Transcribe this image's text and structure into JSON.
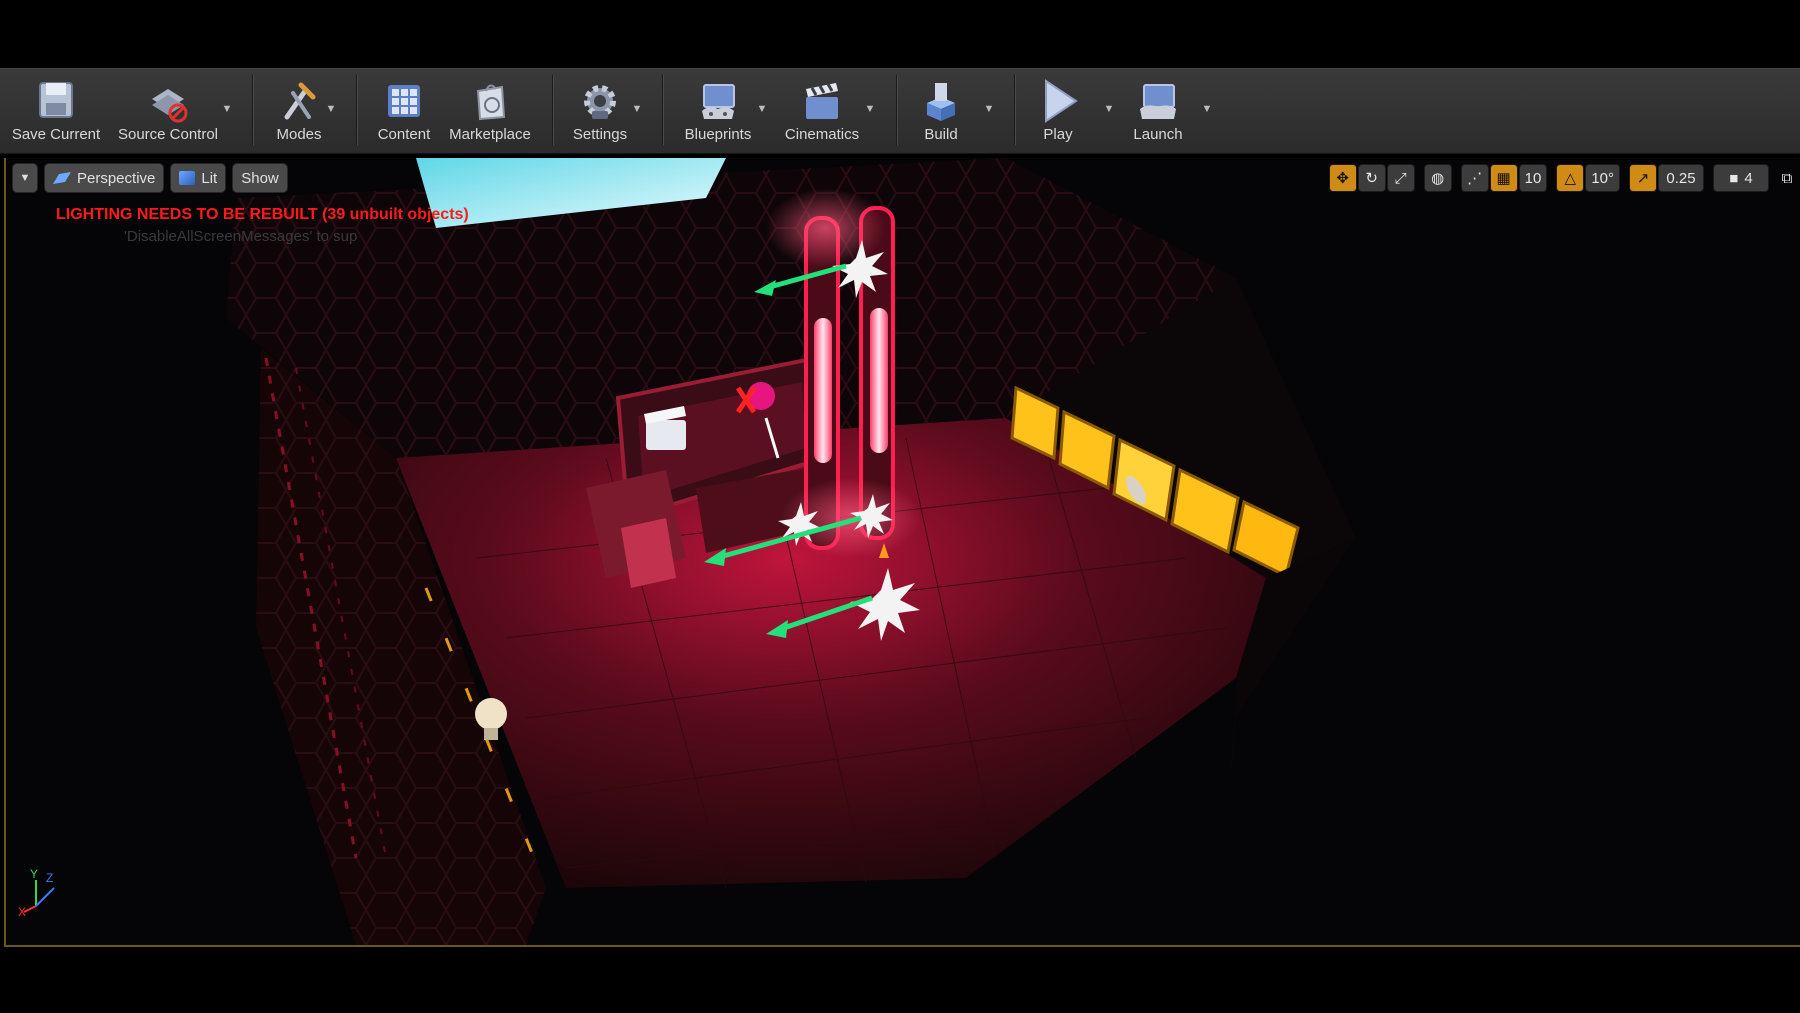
{
  "toolbar": {
    "buttons": [
      {
        "label": "Save Current",
        "icon": "save-icon"
      },
      {
        "label": "Source Control",
        "icon": "source-control-icon"
      },
      {
        "label": "Modes",
        "icon": "modes-icon"
      },
      {
        "label": "Content",
        "icon": "content-browser-icon"
      },
      {
        "label": "Marketplace",
        "icon": "marketplace-icon"
      },
      {
        "label": "Settings",
        "icon": "settings-icon"
      },
      {
        "label": "Blueprints",
        "icon": "blueprints-icon"
      },
      {
        "label": "Cinematics",
        "icon": "cinematics-icon"
      },
      {
        "label": "Build",
        "icon": "build-icon"
      },
      {
        "label": "Play",
        "icon": "play-icon"
      },
      {
        "label": "Launch",
        "icon": "launch-icon"
      }
    ]
  },
  "viewport": {
    "view_mode": "Perspective",
    "lighting_mode": "Lit",
    "show_label": "Show",
    "grid_snap": "10",
    "rotation_snap": "10°",
    "scale_snap": "0.25",
    "camera_speed": "4",
    "warning": "LIGHTING NEEDS TO BE REBUILT (39 unbuilt objects)",
    "warning_sub": "'DisableAllScreenMessages' to sup"
  },
  "colors": {
    "accent": "#d08a16",
    "warning": "#ff1a1a",
    "neon_red": "#ff1f4f",
    "neon_yellow": "#ffc21a",
    "arrow_green": "#22e07a"
  }
}
